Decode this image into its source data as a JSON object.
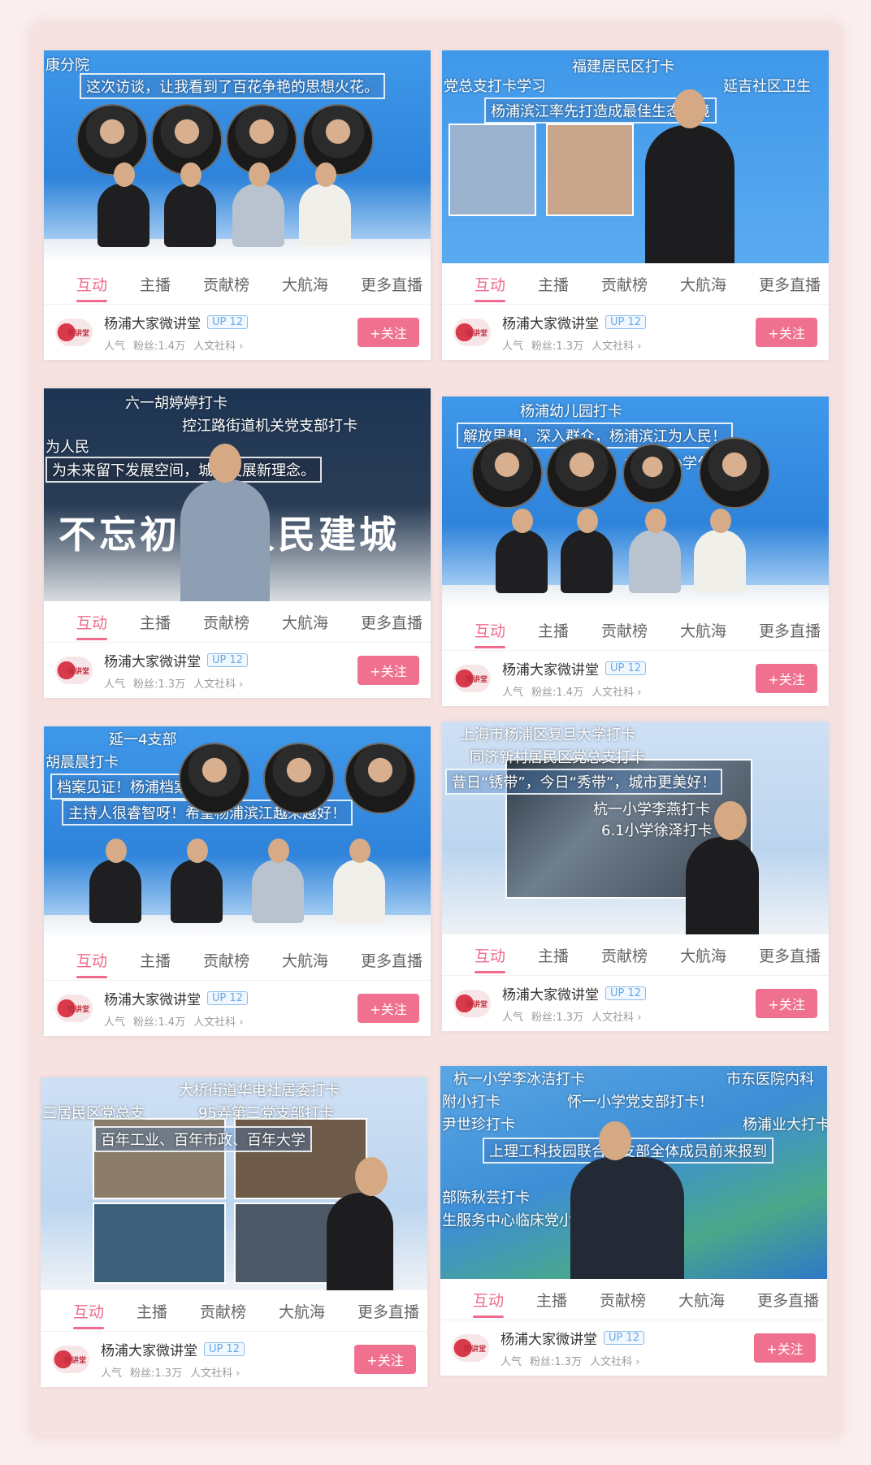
{
  "tabs": [
    "互动",
    "主播",
    "贡献榜",
    "大航海",
    "更多直播"
  ],
  "follow_label": "+关注",
  "channel": {
    "name": "杨浦大家微讲堂",
    "level": "UP 12",
    "popularity_label": "人气",
    "category": "人文社科 ›",
    "logo_text": "微讲堂"
  },
  "accent_color": "#f06b8c",
  "cards": [
    {
      "fans": "粉丝:1.4万",
      "overlays": [
        "康分院",
        "这次访谈，让我看到了百花争艳的思想火花。"
      ]
    },
    {
      "fans": "粉丝:1.3万",
      "overlays": [
        "党总支打卡学习",
        "福建居民区打卡",
        "杨浦滨江率先打造成最佳生态环境",
        "延吉社区卫生"
      ]
    },
    {
      "fans": "粉丝:1.3万",
      "overlays": [
        "六一胡婷婷打卡",
        "控江路街道机关党支部打卡",
        "为人民",
        "为未来留下发展空间，城市发展新理念。",
        "不忘初心 人民建城"
      ]
    },
    {
      "fans": "粉丝:1.4万",
      "overlays": [
        "杨浦幼儿园打卡",
        "解放思想，深入群众，杨浦滨江为人民！",
        "水丰路小学分校打卡"
      ]
    },
    {
      "fans": "粉丝:1.4万",
      "overlays": [
        "延一4支部",
        "胡晨晨打卡",
        "档案见证！杨浦档案馆。",
        "主持人很睿智呀！希望杨浦滨江越来越好！"
      ]
    },
    {
      "fans": "粉丝:1.3万",
      "overlays": [
        "上海市杨浦区复旦大学打卡",
        "同济新村居民区党总支打卡",
        "昔日“锈带”，今日“秀带”，城市更美好！",
        "杭一小学李燕打卡",
        "6.1小学徐泽打卡"
      ]
    },
    {
      "fans": "粉丝:1.3万",
      "overlays": [
        "大桥街道华电社居委打卡",
        "三居民区党总支",
        "95弄第三党支部打卡",
        "百年工业、百年市政、百年大学"
      ]
    },
    {
      "fans": "粉丝:1.3万",
      "overlays": [
        "杭一小学李冰洁打卡",
        "市东医院内科",
        "附小打卡",
        "怀一小学党支部打卡！",
        "尹世珍打卡",
        "杨浦业大打卡",
        "上理工科技园联合二支部全体成员前来报到",
        "部陈秋芸打卡",
        "生服务中心临床党小组打卡"
      ]
    }
  ]
}
